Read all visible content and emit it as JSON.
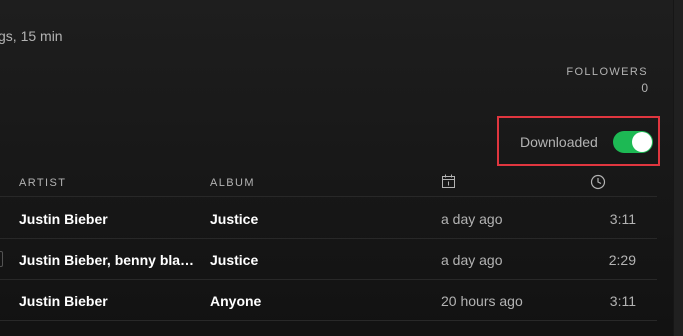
{
  "playlist": {
    "meta_text": "gs, 15 min"
  },
  "followers": {
    "label": "FOLLOWERS",
    "count": "0"
  },
  "download": {
    "label": "Downloaded",
    "enabled": true,
    "toggle_color": "#1db954",
    "highlight_color": "#e0363f"
  },
  "table": {
    "columns": {
      "artist": "ARTIST",
      "album": "ALBUM",
      "date_added_icon": "calendar-icon",
      "duration_icon": "clock-icon"
    },
    "rows": [
      {
        "artist": "Justin Bieber",
        "album": "Justice",
        "added": "a day ago",
        "duration": "3:11"
      },
      {
        "artist": "Justin Bieber, benny blanco",
        "album": "Justice",
        "added": "a day ago",
        "duration": "2:29"
      },
      {
        "artist": "Justin Bieber",
        "album": "Anyone",
        "added": "20 hours ago",
        "duration": "3:11"
      }
    ]
  }
}
